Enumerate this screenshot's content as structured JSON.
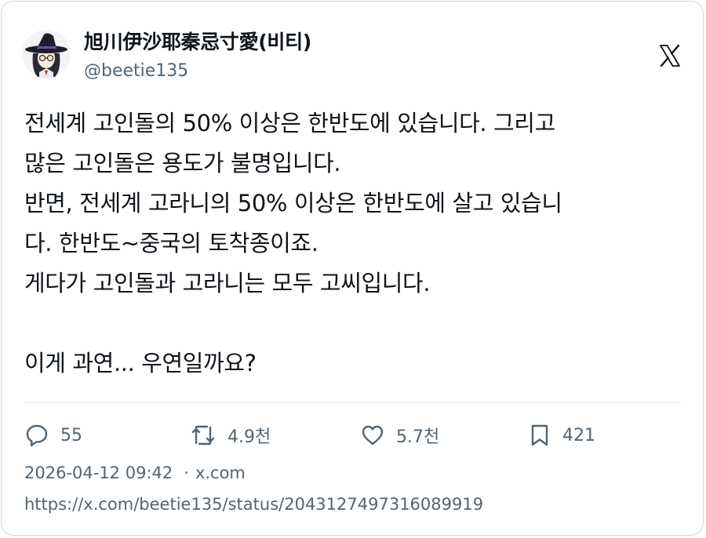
{
  "author": {
    "display_name": "旭川伊沙耶秦忌寸愛(비티)",
    "handle": "@beetie135",
    "avatar_icon": "witch-hat-avatar"
  },
  "platform_icon": "x-logo-icon",
  "tweet": {
    "lines": [
      "전세계 고인돌의 50% 이상은 한반도에 있습니다. 그리고",
      "많은 고인돌은 용도가 불명입니다.",
      "반면, 전세계 고라니의 50% 이상은 한반도에 살고 있습니",
      "다. 한반도~중국의 토착종이죠.",
      "게다가 고인돌과 고라니는 모두 고씨입니다.",
      "",
      "이게 과연... 우연일까요?"
    ]
  },
  "metrics": {
    "replies": {
      "icon": "reply-bubble-icon",
      "count": "55"
    },
    "retweets": {
      "icon": "retweet-icon",
      "count": "4.9천"
    },
    "likes": {
      "icon": "heart-icon",
      "count": "5.7천"
    },
    "bookmarks": {
      "icon": "bookmark-icon",
      "count": "421"
    }
  },
  "meta": {
    "timestamp": "2026-04-12 09:42",
    "separator": "·",
    "source": "x.com",
    "url": "https://x.com/beetie135/status/2043127497316089919"
  },
  "colors": {
    "text_primary": "#0f1419",
    "text_secondary": "#536471",
    "border": "#cfd9de"
  }
}
